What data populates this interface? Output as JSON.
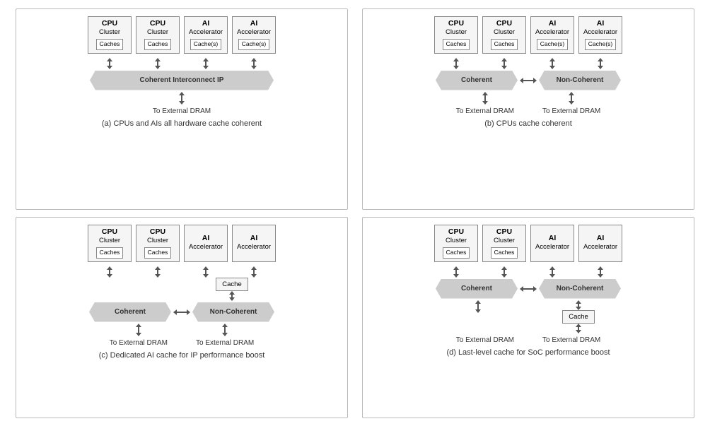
{
  "diagrams": [
    {
      "id": "a",
      "title": "(a) CPUs and AIs all hardware cache coherent",
      "clusters": [
        {
          "title": "CPU",
          "subtitle": "Cluster",
          "cache": "Caches"
        },
        {
          "title": "CPU",
          "subtitle": "Cluster",
          "cache": "Caches"
        },
        {
          "title": "AI",
          "subtitle": "Accelerator",
          "cache": "Cache(s)"
        },
        {
          "title": "AI",
          "subtitle": "Accelerator",
          "cache": "Cache(s)"
        }
      ],
      "layout": "single-banner",
      "banner": "Coherent Interconnect IP",
      "dram": [
        "To External DRAM"
      ]
    },
    {
      "id": "b",
      "title": "(b) CPUs cache coherent",
      "clusters": [
        {
          "title": "CPU",
          "subtitle": "Cluster",
          "cache": "Caches"
        },
        {
          "title": "CPU",
          "subtitle": "Cluster",
          "cache": "Caches"
        },
        {
          "title": "AI",
          "subtitle": "Accelerator",
          "cache": "Cache(s)"
        },
        {
          "title": "AI",
          "subtitle": "Accelerator",
          "cache": "Cache(s)"
        }
      ],
      "layout": "dual-banner",
      "banner1": "Coherent",
      "banner2": "Non-Coherent",
      "dram": [
        "To External DRAM",
        "To External DRAM"
      ]
    },
    {
      "id": "c",
      "title": "(c) Dedicated AI cache for IP performance boost",
      "clusters": [
        {
          "title": "CPU",
          "subtitle": "Cluster",
          "cache": "Caches"
        },
        {
          "title": "CPU",
          "subtitle": "Cluster",
          "cache": "Caches"
        },
        {
          "title": "AI",
          "subtitle": "Accelerator",
          "cache": null
        },
        {
          "title": "AI",
          "subtitle": "Accelerator",
          "cache": null
        }
      ],
      "layout": "dual-banner-cache",
      "banner1": "Coherent",
      "banner2": "Non-Coherent",
      "mid_cache": "Cache",
      "dram": [
        "To External DRAM",
        "To External DRAM"
      ]
    },
    {
      "id": "d",
      "title": "(d) Last-level cache for SoC performance boost",
      "clusters": [
        {
          "title": "CPU",
          "subtitle": "Cluster",
          "cache": "Caches"
        },
        {
          "title": "CPU",
          "subtitle": "Cluster",
          "cache": "Caches"
        },
        {
          "title": "AI",
          "subtitle": "Accelerator",
          "cache": null
        },
        {
          "title": "AI",
          "subtitle": "Accelerator",
          "cache": null
        }
      ],
      "layout": "dual-banner-cache-below",
      "banner1": "Coherent",
      "banner2": "Non-Coherent",
      "bot_cache": "Cache",
      "dram": [
        "To External DRAM",
        "To External DRAM"
      ]
    }
  ]
}
